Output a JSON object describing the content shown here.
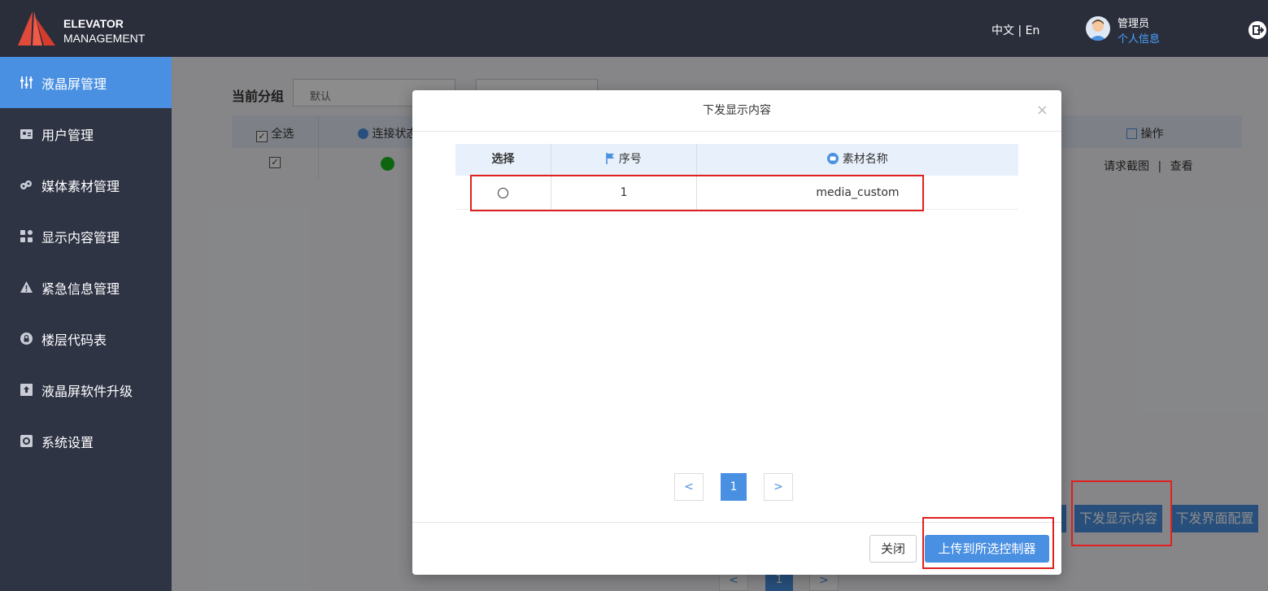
{
  "header": {
    "brand_line1": "ELEVATOR",
    "brand_line2": "MANAGEMENT",
    "lang_zh": "中文",
    "lang_sep": "|",
    "lang_en": "En",
    "user_name": "管理员",
    "user_info_link": "个人信息"
  },
  "sidebar": {
    "items": [
      {
        "label": "液晶屏管理",
        "icon": "sliders-icon",
        "active": true
      },
      {
        "label": "用户管理",
        "icon": "user-card-icon"
      },
      {
        "label": "媒体素材管理",
        "icon": "media-icon"
      },
      {
        "label": "显示内容管理",
        "icon": "grid-icon"
      },
      {
        "label": "紧急信息管理",
        "icon": "warning-icon"
      },
      {
        "label": "楼层代码表",
        "icon": "lock-icon"
      },
      {
        "label": "液晶屏软件升级",
        "icon": "upload-icon"
      },
      {
        "label": "系统设置",
        "icon": "gear-icon"
      }
    ]
  },
  "main": {
    "group_label": "当前分组",
    "group_value": "默认",
    "table_headers": {
      "select_all": "全选",
      "connection": "连接状态",
      "actions": "操作"
    },
    "row_actions": {
      "screenshot": "请求截图",
      "sep": "|",
      "view": "查看"
    },
    "bottom_buttons": {
      "push_content": "下发显示内容",
      "push_ui": "下发界面配置"
    },
    "pager_prev": "<",
    "pager_page": "1",
    "pager_next": ">"
  },
  "modal": {
    "title": "下发显示内容",
    "close_symbol": "×",
    "columns": {
      "select": "选择",
      "index": "序号",
      "name": "素材名称"
    },
    "rows": [
      {
        "index": "1",
        "name": "media_custom"
      }
    ],
    "pager": {
      "prev": "<",
      "page": "1",
      "next": ">"
    },
    "close_button": "关闭",
    "upload_button": "上传到所选控制器"
  },
  "colors": {
    "accent": "#4a90e2",
    "topbar": "#2a2e3b",
    "sidebar": "#2f3445",
    "status_online": "#1db91d",
    "highlight": "#e02020"
  }
}
